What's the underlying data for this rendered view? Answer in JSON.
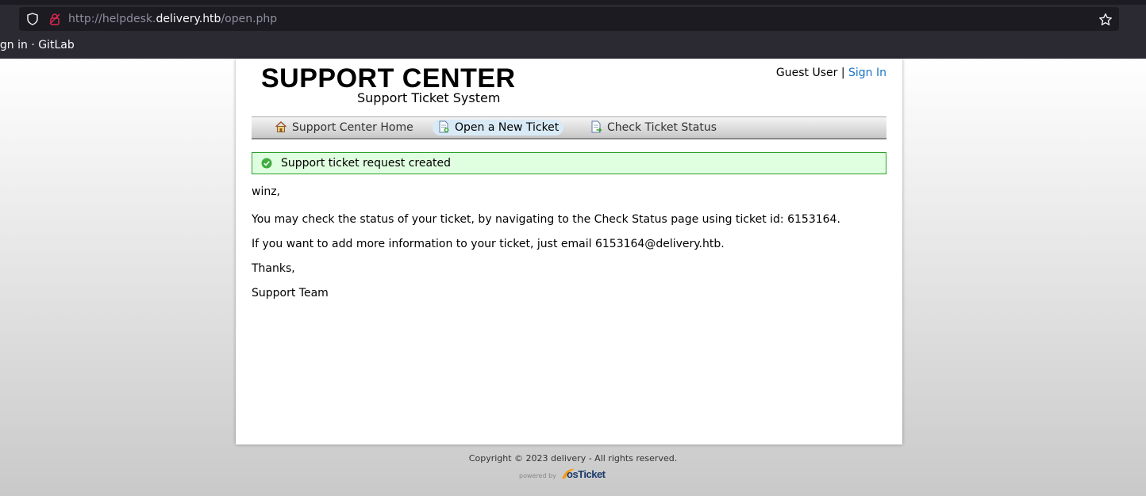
{
  "browser": {
    "url_prefix": "http://helpdesk.",
    "url_host": "delivery.htb",
    "url_path": "/open.php",
    "bookmark": "ign in · GitLab"
  },
  "header": {
    "title": "SUPPORT CENTER",
    "subtitle": "Support Ticket System",
    "guest": "Guest User |",
    "sign_in": "Sign In"
  },
  "nav": [
    {
      "label": "Support Center Home",
      "icon": "home-icon"
    },
    {
      "label": "Open a New Ticket",
      "icon": "new-ticket-icon",
      "active": true
    },
    {
      "label": "Check Ticket Status",
      "icon": "ticket-status-icon"
    }
  ],
  "notice": {
    "message": "Support ticket request created",
    "icon": "check-circle-icon",
    "color": "#2ca02c"
  },
  "content": {
    "greeting": "winz,",
    "line1": "You may check the status of your ticket, by navigating to the Check Status page using ticket id: 6153164.",
    "line2": "If you want to add more information to your ticket, just email 6153164@delivery.htb.",
    "thanks": "Thanks,",
    "signature": "Support Team"
  },
  "footer": {
    "copyright": "Copyright © 2023 delivery - All rights reserved.",
    "powered_by": "powered by",
    "brand": "osTicket"
  }
}
